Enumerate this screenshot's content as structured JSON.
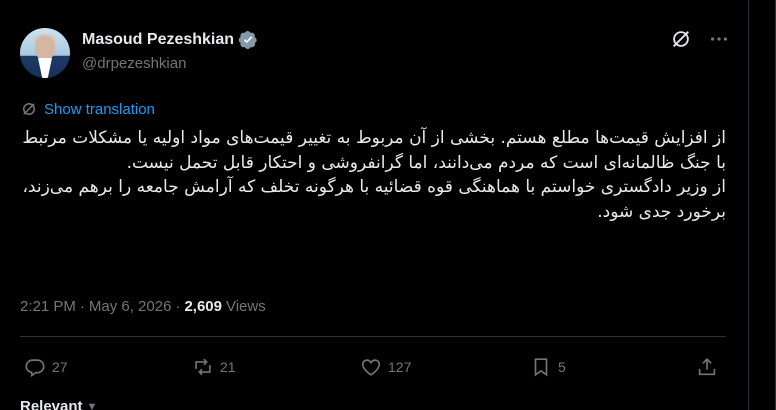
{
  "author": {
    "display_name": "Masoud Pezeshkian",
    "handle": "@drpezeshkian",
    "verified_icon": "verified-badge-icon"
  },
  "top_actions": {
    "grok_icon": "grok-icon",
    "more_icon": "more-icon"
  },
  "translation": {
    "label": "Show translation",
    "icon": "translate-icon"
  },
  "post": {
    "paragraphs": [
      "از افزایش قیمت‌ها مطلع هستم. بخشی از  آن مربوط به تغییر قیمت‌های مواد اولیه یا مشکلات مرتبط با جنگ ظالمانه‌ای است که مردم می‌دانند، اما گرانفروشی و احتکار قابل تحمل نیست.",
      "از وزیر دادگستری خواستم با هماهنگی قوه قضائیه با هرگونه تخلف که آرامش جامعه را برهم می‌زند، برخورد جدی شود."
    ]
  },
  "meta": {
    "time": "2:21 PM",
    "separator": "·",
    "date": "May 6, 2026",
    "views_count": "2,609",
    "views_label": "Views"
  },
  "actions": {
    "replies": "27",
    "reposts": "21",
    "likes": "127",
    "bookmarks": "5"
  },
  "footer": {
    "relevant_label": "Relevant"
  },
  "colors": {
    "background": "#000000",
    "text": "#e7e9ea",
    "secondary": "#71767b",
    "accent": "#1d9bf0",
    "border": "#2f3336"
  }
}
